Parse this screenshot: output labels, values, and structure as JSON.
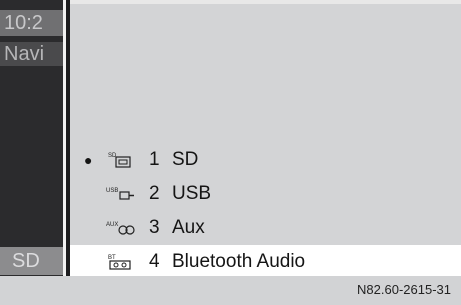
{
  "sidebar": {
    "time": "10:2",
    "navi_label": "Navi",
    "source_label": "SD"
  },
  "menu": {
    "items": [
      {
        "num": "1",
        "label": "SD",
        "icon": "sd-card-icon",
        "icon_text": "SD",
        "active": true,
        "selected": false
      },
      {
        "num": "2",
        "label": "USB",
        "icon": "usb-icon",
        "icon_text": "USB",
        "active": false,
        "selected": false
      },
      {
        "num": "3",
        "label": "Aux",
        "icon": "aux-icon",
        "icon_text": "AUX",
        "active": false,
        "selected": false
      },
      {
        "num": "4",
        "label": "Bluetooth Audio",
        "icon": "bluetooth-audio-icon",
        "icon_text": "BT",
        "active": false,
        "selected": true
      }
    ]
  },
  "footer": {
    "reference": "N82.60-2615-31"
  }
}
